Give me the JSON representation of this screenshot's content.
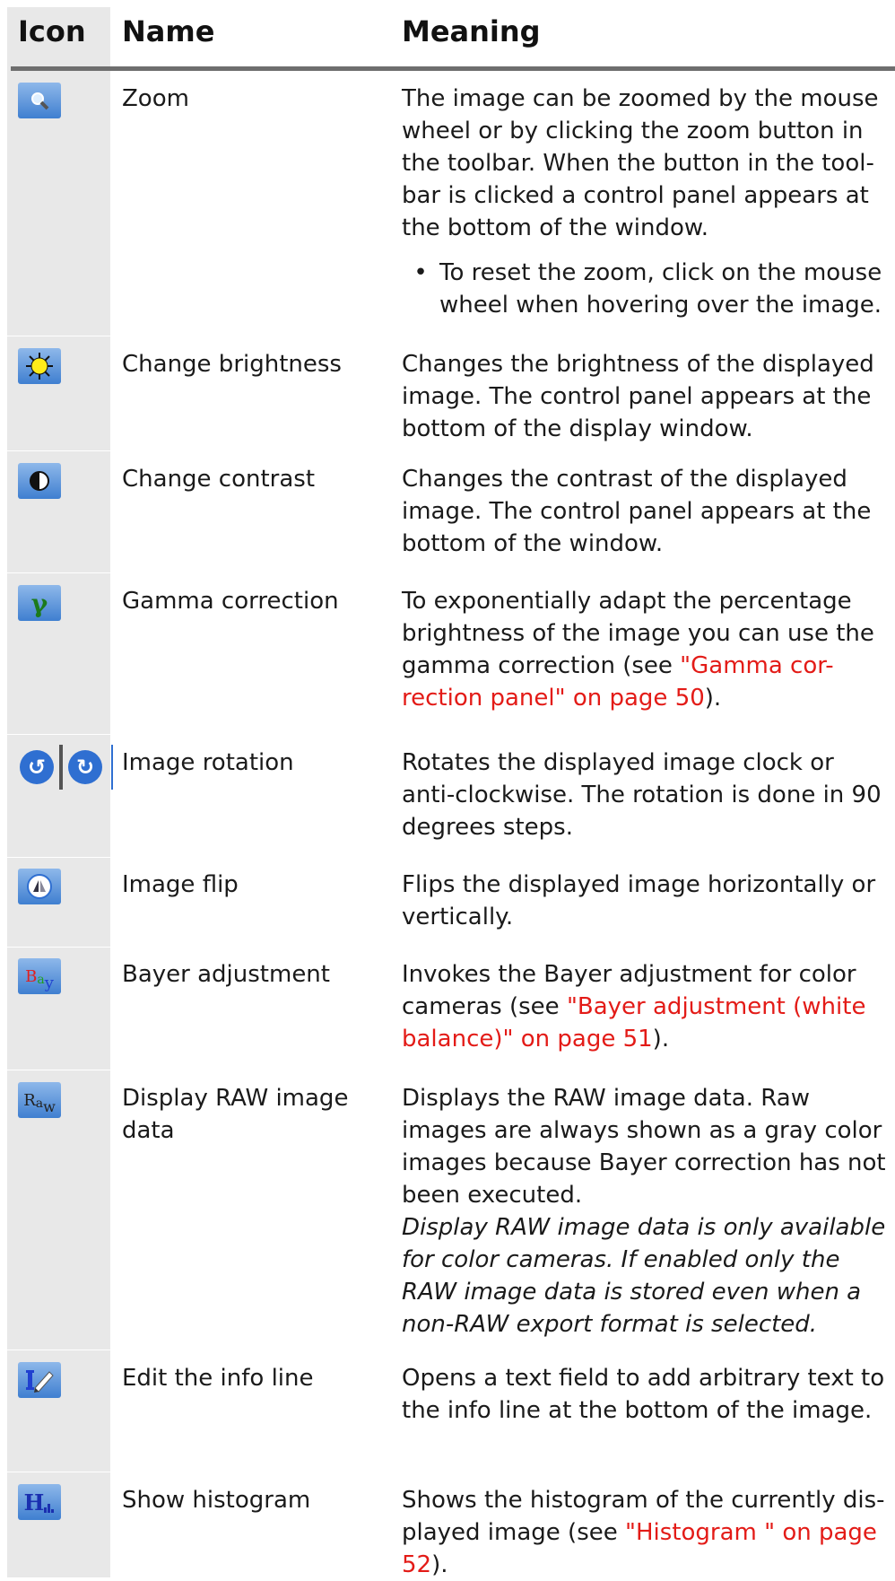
{
  "headers": {
    "icon": "Icon",
    "name": "Name",
    "meaning": "Meaning"
  },
  "rows": [
    {
      "icon": "zoom-icon",
      "name": "Zoom",
      "meaning": "The image can be zoomed by the mouse wheel or by clicking the zoom button in the toolbar. When the button in the tool-bar is clicked a control panel appears at the bottom of the window.",
      "bullet": "To reset the zoom, click on the mouse wheel when hovering over the image."
    },
    {
      "icon": "brightness-icon",
      "name": "Change brightness",
      "meaning": "Changes the brightness of the displayed image. The control panel appears at the bottom of the display window."
    },
    {
      "icon": "contrast-icon",
      "name": "Change contrast",
      "meaning": "Changes the contrast of the displayed image. The control panel appears at the bottom of the window."
    },
    {
      "icon": "gamma-icon",
      "name": "Gamma correction",
      "meaning_pre": "To exponentially adapt the percentage brightness of the image you can use the gamma correction (see ",
      "meaning_link": "\"Gamma cor-rection panel\" on page 50",
      "meaning_post": ")."
    },
    {
      "icon": "rotate-icons",
      "name": "Image rotation",
      "meaning": "Rotates the displayed image clock or anti-clockwise. The rotation is done in 90 degrees steps."
    },
    {
      "icon": "flip-icon",
      "name": "Image flip",
      "meaning": "Flips the displayed image horizontally or vertically."
    },
    {
      "icon": "bayer-icon",
      "name": "Bayer adjustment",
      "meaning_pre": "Invokes the Bayer adjustment for color cameras (see ",
      "meaning_link": "\"Bayer adjustment (white balance)\" on page 51",
      "meaning_post": ")."
    },
    {
      "icon": "raw-icon",
      "name": "Display RAW image data",
      "meaning": "Displays the RAW image data. Raw images are always shown as a gray color images because Bayer correction has not been executed.",
      "note": "Display RAW image data is only available for color cameras. If enabled only the RAW image data is stored even when a non-RAW export format is selected."
    },
    {
      "icon": "edit-info-icon",
      "name": "Edit the info line",
      "meaning": "Opens a text field to add arbitrary text to the info line at the bottom of the image."
    },
    {
      "icon": "histogram-icon",
      "name": "Show histogram",
      "meaning_pre": "Shows the histogram of the currently dis-played image (see ",
      "meaning_link": "\"Histogram \" on page 52",
      "meaning_post": ")."
    }
  ]
}
